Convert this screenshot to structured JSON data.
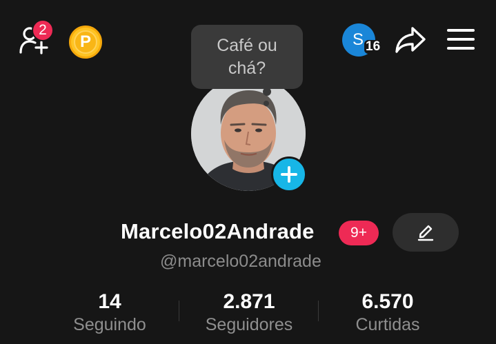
{
  "header": {
    "friend_requests_count": "2",
    "coin_label": "P",
    "account_initial": "S",
    "account_notifications": "16"
  },
  "note": {
    "text": "Café ou chá?"
  },
  "profile": {
    "display_name": "Marcelo02Andrade",
    "level_badge": "9+",
    "handle": "@marcelo02andrade"
  },
  "stats": [
    {
      "value": "14",
      "label": "Seguindo"
    },
    {
      "value": "2.871",
      "label": "Seguidores"
    },
    {
      "value": "6.570",
      "label": "Curtidas"
    }
  ],
  "colors": {
    "background": "#161616",
    "accent_red": "#ee2a55",
    "story_blue": "#17b6e7",
    "coin_gold": "#ffc423",
    "account_blue": "#1a86d8"
  }
}
